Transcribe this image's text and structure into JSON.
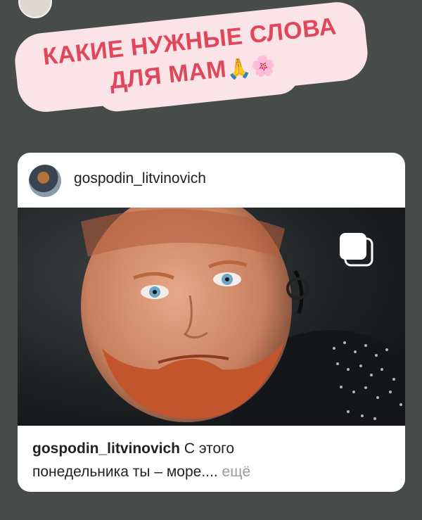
{
  "story": {
    "sticker": {
      "line1": "КАКИЕ НУЖНЫЕ СЛОВА",
      "line2": "ДЛЯ МАМ",
      "emojis": "🙏🌸"
    }
  },
  "post": {
    "username": "gospodin_litvinovich",
    "caption_user": "gospodin_litvinovich",
    "caption_text_1": "С этого",
    "caption_text_2": "понедельника ты – море....",
    "more_label": "ещё",
    "multi_photo_icon": "carousel-icon"
  }
}
